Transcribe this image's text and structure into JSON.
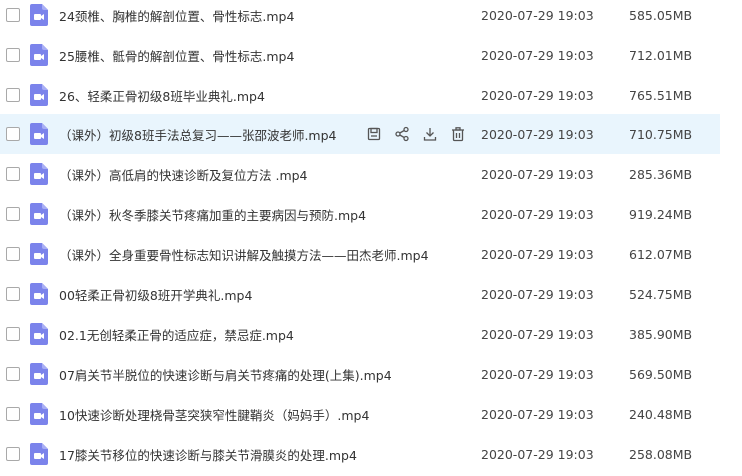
{
  "files": [
    {
      "name": "24颈椎、胸椎的解剖位置、骨性标志.mp4",
      "date": "2020-07-29 19:03",
      "size": "585.05MB"
    },
    {
      "name": "25腰椎、骶骨的解剖位置、骨性标志.mp4",
      "date": "2020-07-29 19:03",
      "size": "712.01MB"
    },
    {
      "name": "26、轻柔正骨初级8班毕业典礼.mp4",
      "date": "2020-07-29 19:03",
      "size": "765.51MB"
    },
    {
      "name": "（课外）初级8班手法总复习——张邵波老师.mp4",
      "date": "2020-07-29 19:03",
      "size": "710.75MB",
      "hovered": true
    },
    {
      "name": "（课外）高低肩的快速诊断及复位方法 .mp4",
      "date": "2020-07-29 19:03",
      "size": "285.36MB"
    },
    {
      "name": "（课外）秋冬季膝关节疼痛加重的主要病因与预防.mp4",
      "date": "2020-07-29 19:03",
      "size": "919.24MB"
    },
    {
      "name": "（课外）全身重要骨性标志知识讲解及触摸方法——田杰老师.mp4",
      "date": "2020-07-29 19:03",
      "size": "612.07MB"
    },
    {
      "name": "00轻柔正骨初级8班开学典礼.mp4",
      "date": "2020-07-29 19:03",
      "size": "524.75MB"
    },
    {
      "name": "02.1无创轻柔正骨的适应症，禁忌症.mp4",
      "date": "2020-07-29 19:03",
      "size": "385.90MB"
    },
    {
      "name": "07肩关节半脱位的快速诊断与肩关节疼痛的处理(上集).mp4",
      "date": "2020-07-29 19:03",
      "size": "569.50MB"
    },
    {
      "name": "10快速诊断处理桡骨茎突狭窄性腱鞘炎（妈妈手）.mp4",
      "date": "2020-07-29 19:03",
      "size": "240.48MB"
    },
    {
      "name": "17膝关节移位的快速诊断与膝关节滑膜炎的处理.mp4",
      "date": "2020-07-29 19:03",
      "size": "258.08MB"
    }
  ],
  "row_actions": [
    "save-icon",
    "share-icon",
    "download-icon",
    "delete-icon"
  ],
  "colors": {
    "accent": "#7b83eb",
    "hover_bg": "#e9f5fd",
    "icon_gray": "#555555"
  }
}
